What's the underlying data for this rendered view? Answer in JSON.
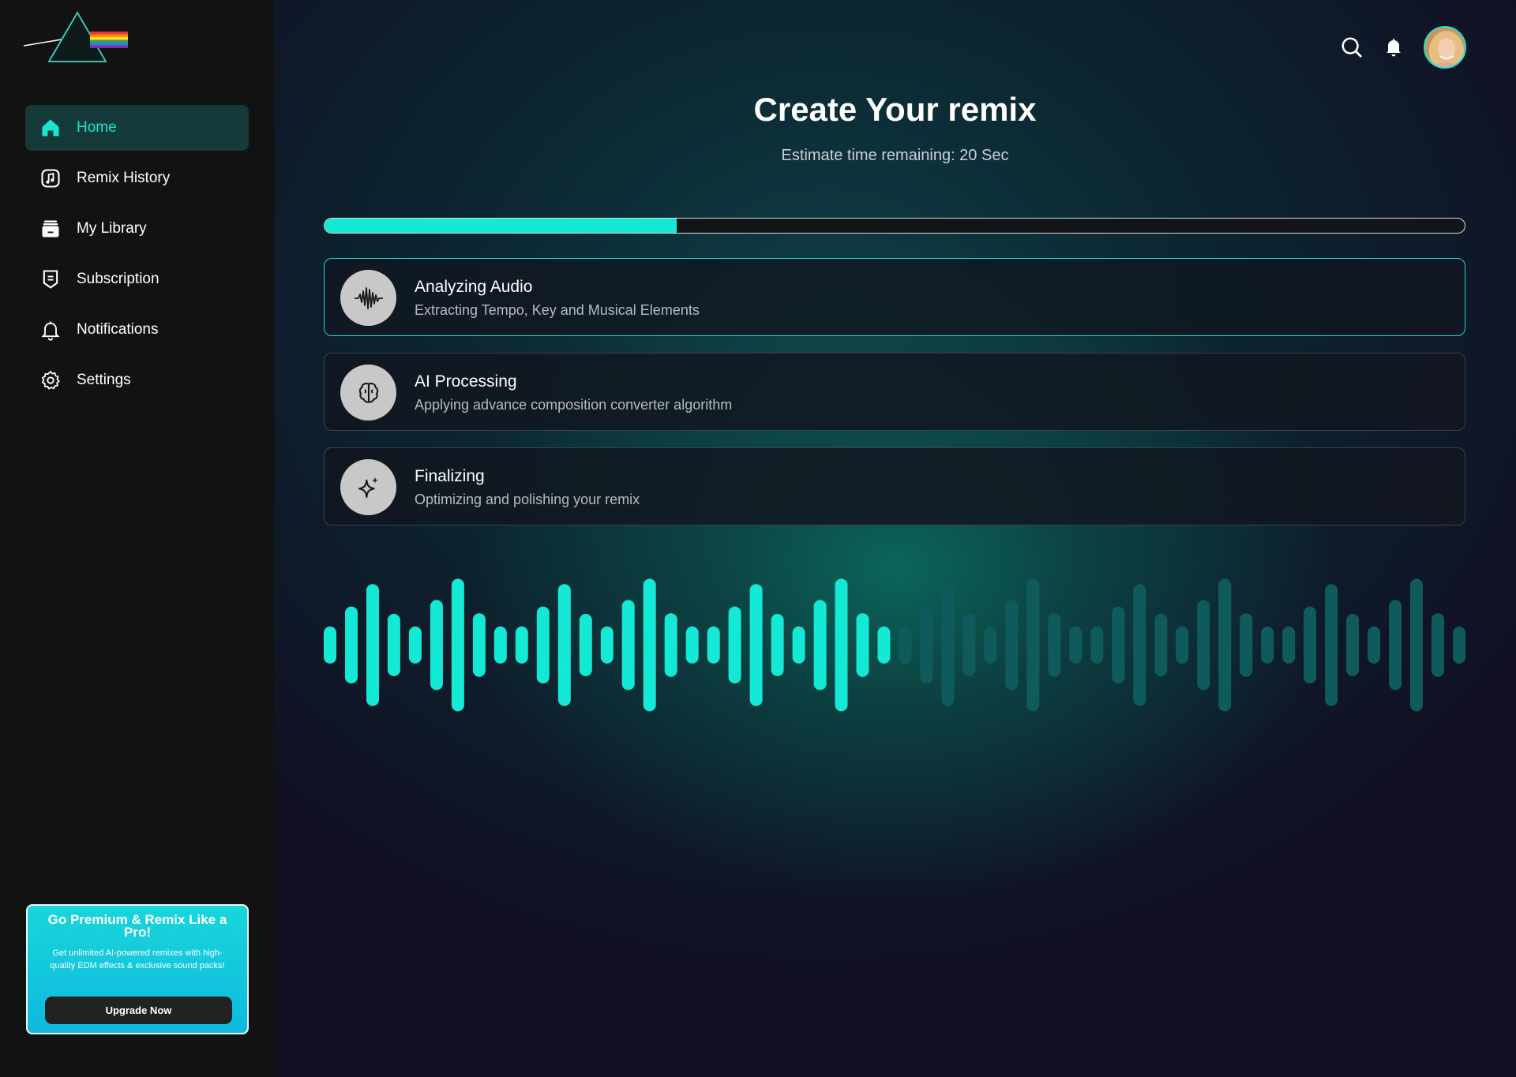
{
  "sidebar": {
    "items": [
      {
        "label": "Home",
        "icon": "home-icon",
        "active": true
      },
      {
        "label": "Remix History",
        "icon": "music-note-icon",
        "active": false
      },
      {
        "label": "My Library",
        "icon": "library-icon",
        "active": false
      },
      {
        "label": "Subscription",
        "icon": "subscription-icon",
        "active": false
      },
      {
        "label": "Notifications",
        "icon": "bell-icon",
        "active": false
      },
      {
        "label": "Settings",
        "icon": "gear-icon",
        "active": false
      }
    ],
    "promo": {
      "title": "Go Premium & Remix Like a Pro!",
      "text": "Get unlimited AI-powered remixes with high-quality EDM effects & exclusive sound packs!",
      "button": "Upgrade Now"
    }
  },
  "header": {
    "icons": [
      "search-icon",
      "bell-icon",
      "avatar"
    ]
  },
  "main": {
    "title": "Create Your remix",
    "subtitle": "Estimate time remaining: 20 Sec",
    "progress": 0.309,
    "steps": [
      {
        "title": "Analyzing Audio",
        "desc": "Extracting Tempo, Key and Musical Elements",
        "icon": "waveform-icon",
        "active": true
      },
      {
        "title": "AI Processing",
        "desc": "Applying advance composition converter algorithm",
        "icon": "brain-icon",
        "active": false
      },
      {
        "title": "Finalizing",
        "desc": "Optimizing and polishing your remix",
        "icon": "sparkle-icon",
        "active": false
      }
    ],
    "waveform": {
      "played_bars": 27,
      "bar_heights": [
        0.28,
        0.58,
        0.92,
        0.47,
        0.28,
        0.68,
        1.0,
        0.48,
        0.28,
        0.28,
        0.58,
        0.92,
        0.47,
        0.28,
        0.68,
        1.0,
        0.48,
        0.28,
        0.28,
        0.58,
        0.92,
        0.47,
        0.28,
        0.68,
        1.0,
        0.48,
        0.28,
        0.28,
        0.58,
        0.92,
        0.47,
        0.28,
        0.68,
        1.0,
        0.48,
        0.28,
        0.28,
        0.58,
        0.92,
        0.47,
        0.28,
        0.68,
        1.0,
        0.48,
        0.28,
        0.28,
        0.58,
        0.92,
        0.47,
        0.28,
        0.68,
        1.0,
        0.48,
        0.28
      ],
      "played_color": "#14e9d6",
      "unplayed_color": "#0f5b5c"
    }
  },
  "colors": {
    "accent": "#17e6d3",
    "sidebar_bg": "#121212",
    "active_nav_bg": "#143a3a"
  }
}
